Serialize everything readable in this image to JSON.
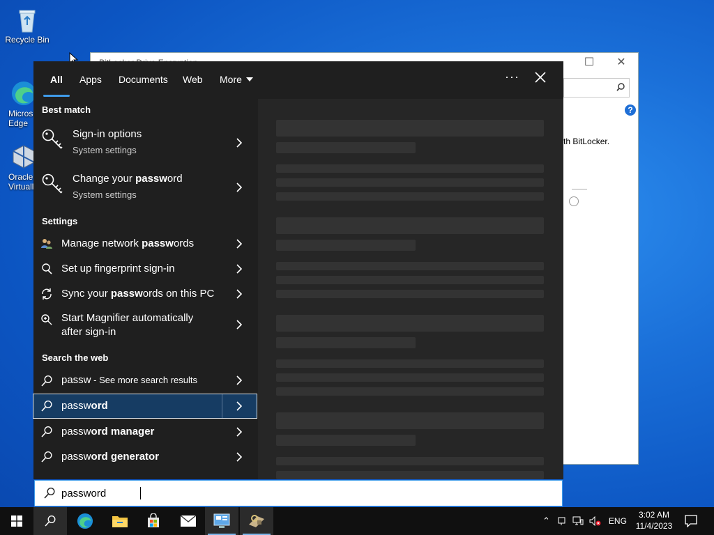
{
  "desktop": {
    "icons": [
      {
        "label": "Recycle Bin"
      },
      {
        "label": "Micros Edge"
      },
      {
        "label": "Oracle Virtuall"
      }
    ]
  },
  "background_window": {
    "title": "BitLocker Drive Encryption",
    "text": "th BitLocker.",
    "help": "?"
  },
  "search_panel": {
    "tabs": [
      "All",
      "Apps",
      "Documents",
      "Web",
      "More"
    ],
    "sections": {
      "best_match": "Best match",
      "settings": "Settings",
      "search_web": "Search the web"
    },
    "best_match": [
      {
        "pre": "Sign-in options",
        "bold": "",
        "post": "",
        "sub": "System settings"
      },
      {
        "pre": "Change your ",
        "bold": "passw",
        "post": "ord",
        "sub": "System settings"
      }
    ],
    "settings": [
      {
        "pre": "Manage network ",
        "bold": "passw",
        "post": "ords"
      },
      {
        "pre": "Set up fingerprint sign-in",
        "bold": "",
        "post": ""
      },
      {
        "pre": "Sync your ",
        "bold": "passw",
        "post": "ords on this PC"
      },
      {
        "line1": "Start Magnifier automatically",
        "line2": "after sign-in"
      }
    ],
    "web": [
      {
        "pre": "passw",
        "bold": "",
        "post": "",
        "sub": " - See more search results"
      },
      {
        "pre": "passw",
        "bold": "ord",
        "post": ""
      },
      {
        "pre": "passw",
        "bold": "ord manager",
        "post": ""
      },
      {
        "pre": "passw",
        "bold": "ord generator",
        "post": ""
      }
    ]
  },
  "search_box": {
    "value": "password"
  },
  "taskbar": {
    "tray_lang": "ENG",
    "time": "3:02 AM",
    "date": "11/4/2023"
  }
}
